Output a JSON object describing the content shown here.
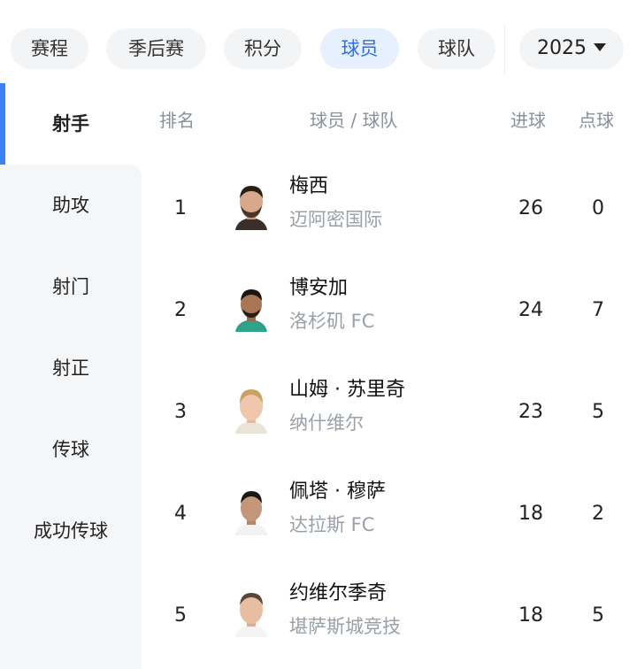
{
  "tabs": [
    {
      "label": "赛程",
      "active": false
    },
    {
      "label": "季后赛",
      "active": false
    },
    {
      "label": "积分",
      "active": false
    },
    {
      "label": "球员",
      "active": true
    },
    {
      "label": "球队",
      "active": false
    }
  ],
  "year_select": {
    "value": "2025"
  },
  "sidebar": {
    "items": [
      {
        "label": "射手",
        "active": true
      },
      {
        "label": "助攻",
        "active": false
      },
      {
        "label": "射门",
        "active": false
      },
      {
        "label": "射正",
        "active": false
      },
      {
        "label": "传球",
        "active": false
      },
      {
        "label": "成功传球",
        "active": false
      }
    ]
  },
  "table": {
    "headers": {
      "rank": "排名",
      "player_team": "球员 / 球队",
      "goals": "进球",
      "penalties": "点球"
    },
    "rows": [
      {
        "rank": "1",
        "name": "梅西",
        "team": "迈阿密国际",
        "goals": "26",
        "penalties": "0"
      },
      {
        "rank": "2",
        "name": "博安加",
        "team": "洛杉矶 FC",
        "goals": "24",
        "penalties": "7"
      },
      {
        "rank": "3",
        "name": "山姆 · 苏里奇",
        "team": "纳什维尔",
        "goals": "23",
        "penalties": "5"
      },
      {
        "rank": "4",
        "name": "佩塔 · 穆萨",
        "team": "达拉斯 FC",
        "goals": "18",
        "penalties": "2"
      },
      {
        "rank": "5",
        "name": "约维尔季奇",
        "team": "堪萨斯城竞技",
        "goals": "18",
        "penalties": "5"
      }
    ]
  },
  "colors": {
    "accent": "#3b82f6",
    "active_tab_bg": "#e7f0ff",
    "active_tab_text": "#2f6fe4"
  }
}
